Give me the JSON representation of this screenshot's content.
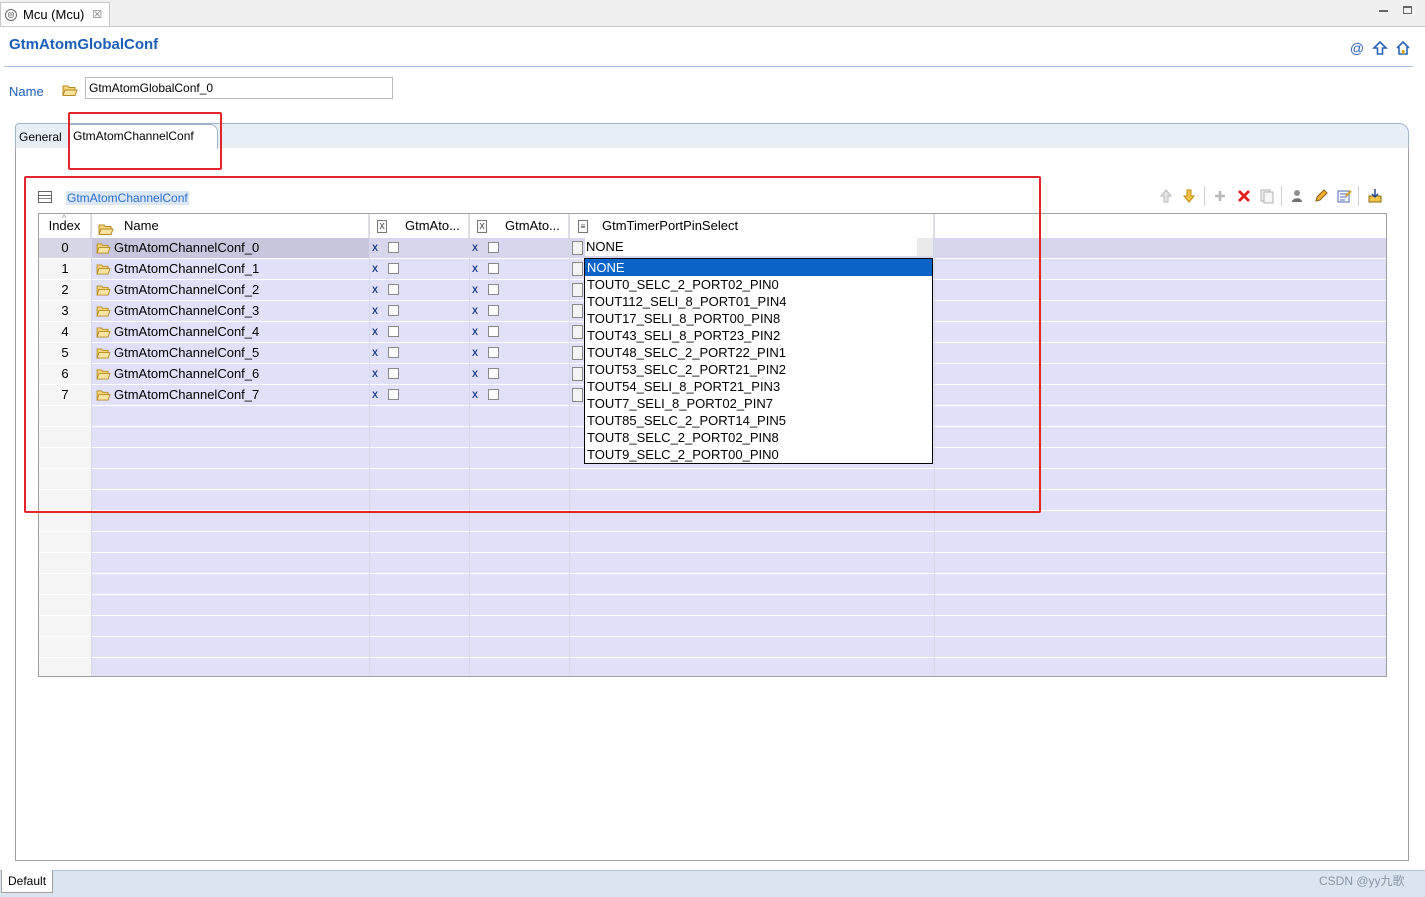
{
  "editor_tab": {
    "title": "Mcu (Mcu)",
    "close": "☒"
  },
  "window_controls": {
    "minimize": "▭",
    "maximize": "▭"
  },
  "header": {
    "title": "GtmAtomGlobalConf",
    "icons": [
      "at-icon",
      "up-icon",
      "home-icon"
    ]
  },
  "name_field": {
    "label": "Name",
    "value": "GtmAtomGlobalConf_0"
  },
  "tabs": [
    {
      "label": "General"
    },
    {
      "label": "GtmAtomChannelConf",
      "active": true
    }
  ],
  "section": {
    "title": "GtmAtomChannelConf"
  },
  "toolbar": [
    "move-up-icon",
    "move-down-icon",
    "add-icon",
    "delete-icon",
    "copy-icon",
    "user-icon",
    "edit-icon",
    "table-edit-icon",
    "export-icon"
  ],
  "table": {
    "columns": [
      "Index",
      "Name",
      "GtmAto...",
      "GtmAto...",
      "GtmTimerPortPinSelect"
    ],
    "rows": [
      {
        "index": "0",
        "name": "GtmAtomChannelConf_0"
      },
      {
        "index": "1",
        "name": "GtmAtomChannelConf_1"
      },
      {
        "index": "2",
        "name": "GtmAtomChannelConf_2"
      },
      {
        "index": "3",
        "name": "GtmAtomChannelConf_3"
      },
      {
        "index": "4",
        "name": "GtmAtomChannelConf_4"
      },
      {
        "index": "5",
        "name": "GtmAtomChannelConf_5"
      },
      {
        "index": "6",
        "name": "GtmAtomChannelConf_6"
      },
      {
        "index": "7",
        "name": "GtmAtomChannelConf_7"
      }
    ],
    "selected_row": 0,
    "pin_select_value": "NONE"
  },
  "dropdown": {
    "options": [
      "NONE",
      "TOUT0_SELC_2_PORT02_PIN0",
      "TOUT112_SELI_8_PORT01_PIN4",
      "TOUT17_SELI_8_PORT00_PIN8",
      "TOUT43_SELI_8_PORT23_PIN2",
      "TOUT48_SELC_2_PORT22_PIN1",
      "TOUT53_SELC_2_PORT21_PIN2",
      "TOUT54_SELI_8_PORT21_PIN3",
      "TOUT7_SELI_8_PORT02_PIN7",
      "TOUT85_SELC_2_PORT14_PIN5",
      "TOUT8_SELC_2_PORT02_PIN8",
      "TOUT9_SELC_2_PORT00_PIN0"
    ],
    "highlighted": 0
  },
  "bottom_tab": {
    "label": "Default"
  },
  "watermark": "CSDN @yy九歌"
}
